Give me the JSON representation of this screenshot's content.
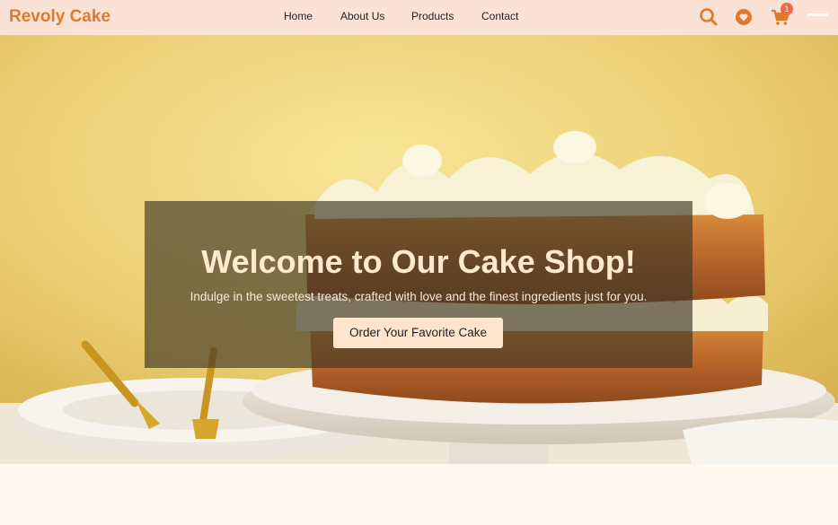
{
  "brand": {
    "name": "Revoly Cake",
    "color": "#e0792b"
  },
  "nav": {
    "links": [
      "Home",
      "About Us",
      "Products",
      "Contact"
    ]
  },
  "actions": {
    "search_icon": "search-icon",
    "favorites_icon": "heart-icon",
    "cart_icon": "cart-icon",
    "cart_count": "1",
    "menu_icon": "menu-icon"
  },
  "hero": {
    "title": "Welcome to Our Cake Shop!",
    "subtitle": "Indulge in the sweetest treats, crafted with love and the finest ingredients just for you.",
    "cta_label": "Order Your Favorite Cake"
  },
  "colors": {
    "navbar_bg": "#fbe2d6",
    "accent": "#e0792b",
    "badge": "#ef6a45",
    "cta_bg": "#ffe5cb"
  }
}
